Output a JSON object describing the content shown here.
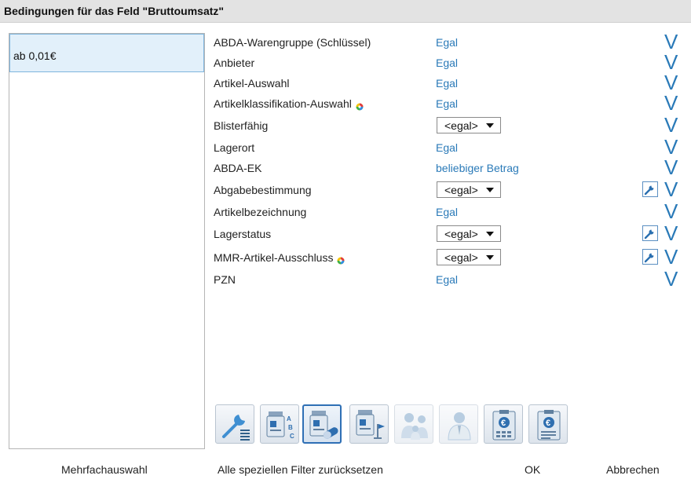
{
  "dialog": {
    "title": "Bedingungen für das Feld \"Bruttoumsatz\""
  },
  "left_list": {
    "items": [
      {
        "label": "ab 0,01€"
      }
    ]
  },
  "conditions": [
    {
      "label": "ABDA-Warengruppe (Schlüssel)",
      "value": "Egal",
      "kind": "link"
    },
    {
      "label": "Anbieter",
      "value": "Egal",
      "kind": "link"
    },
    {
      "label": "Artikel-Auswahl",
      "value": "Egal",
      "kind": "link"
    },
    {
      "label": "Artikelklassifikation-Auswahl",
      "value": "Egal",
      "kind": "link",
      "badge": "color-wheel-icon"
    },
    {
      "label": "Blisterfähig",
      "value": "<egal>",
      "kind": "dropdown"
    },
    {
      "label": "Lagerort",
      "value": "Egal",
      "kind": "link"
    },
    {
      "label": "ABDA-EK",
      "value": "beliebiger Betrag",
      "kind": "link"
    },
    {
      "label": "Abgabebestimmung",
      "value": "<egal>",
      "kind": "dropdown",
      "wrench": true
    },
    {
      "label": "Artikelbezeichnung",
      "value": "Egal",
      "kind": "link"
    },
    {
      "label": "Lagerstatus",
      "value": "<egal>",
      "kind": "dropdown",
      "wrench": true
    },
    {
      "label": "MMR-Artikel-Ausschluss",
      "value": "<egal>",
      "kind": "dropdown",
      "wrench": true,
      "badge": "color-wheel-icon"
    },
    {
      "label": "PZN",
      "value": "Egal",
      "kind": "link"
    }
  ],
  "row_toggle_glyph": "V",
  "toolbar": [
    {
      "name": "wrench-list-icon",
      "active": false
    },
    {
      "name": "article-abc-icon",
      "active": false
    },
    {
      "name": "article-pill-icon",
      "active": true
    },
    {
      "name": "article-flag-icon",
      "active": false
    },
    {
      "name": "family-icon",
      "active": false,
      "dim": true
    },
    {
      "name": "pharmacist-icon",
      "active": false,
      "dim": true
    },
    {
      "name": "euro-clipboard-icon",
      "active": false
    },
    {
      "name": "euro-clipboard-2-icon",
      "active": false
    }
  ],
  "buttons": {
    "multi_select": "Mehrfachauswahl",
    "reset_filters": "Alle speziellen Filter zurücksetzen",
    "ok": "OK",
    "cancel": "Abbrechen"
  },
  "colors": {
    "accent": "#2a7ab8",
    "selection": "#e2f0fa",
    "titlebar": "#e3e3e3"
  }
}
